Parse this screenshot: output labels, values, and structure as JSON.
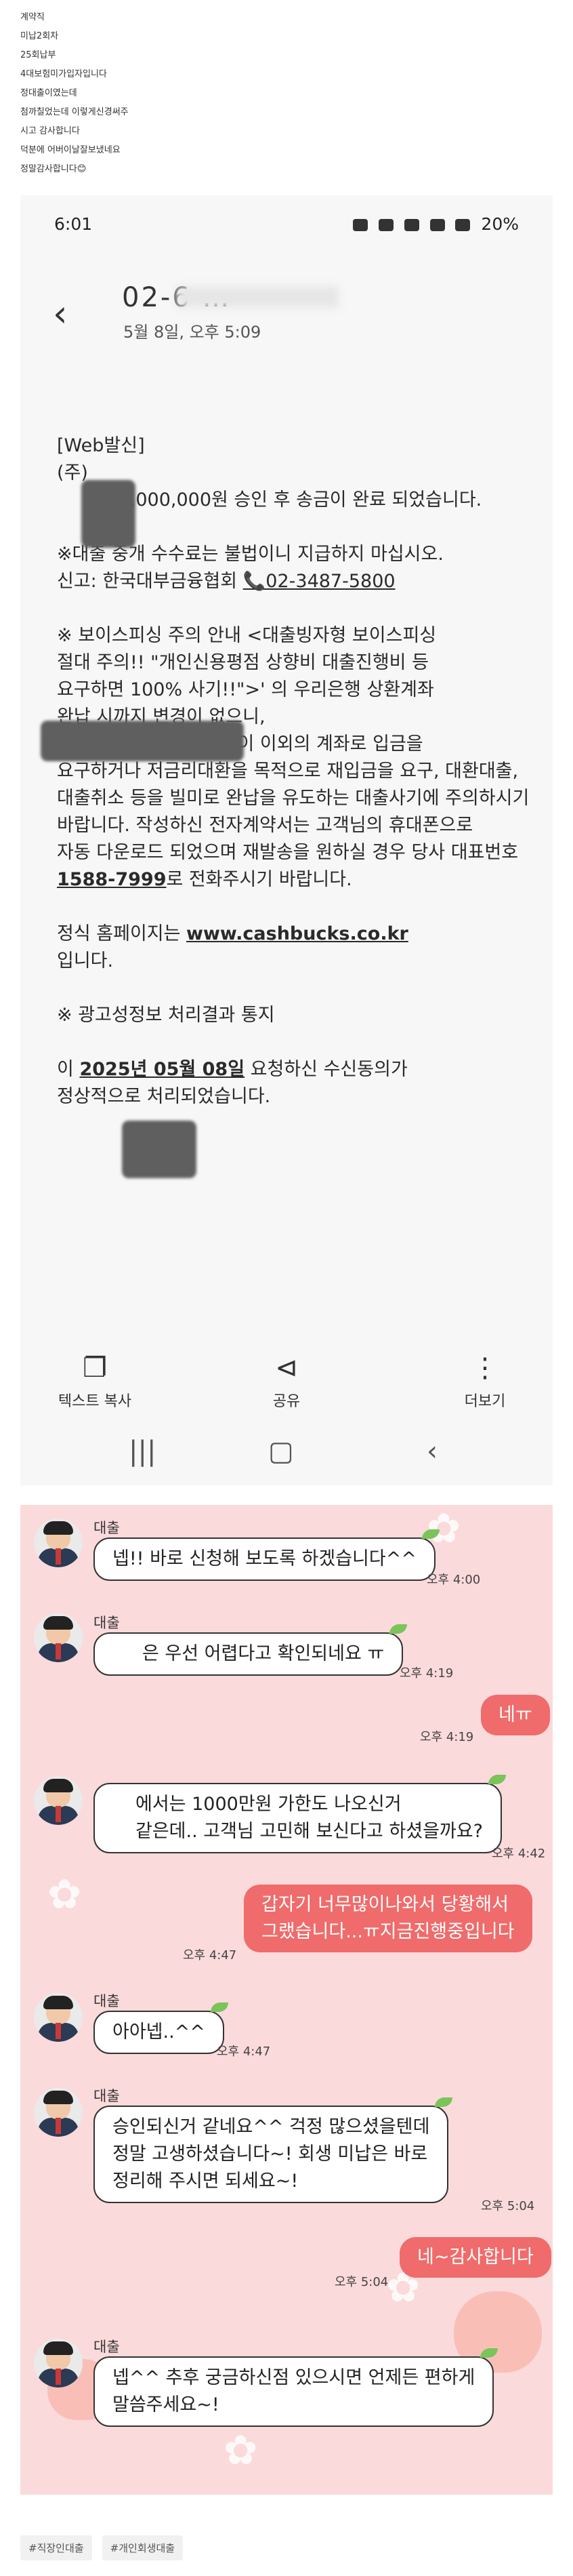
{
  "intro": {
    "lines": [
      "계약직",
      "미납2회차",
      "25회납부",
      "4대보험미가입자입니다",
      "정대출이였는데",
      "첨까칠었는데 이렇게신경써주",
      "시고 감사합니다",
      "덕분에 어버이날잘보냈네요",
      "정말감사합니다😊"
    ]
  },
  "phone": {
    "status": {
      "time": "6:01",
      "battery": "20%"
    },
    "header": {
      "back_icon": "chevron-left",
      "sender": "02-6 …",
      "date": "5월 8일, 오후 5:09"
    },
    "sms": {
      "line1": "[Web발신]",
      "line2": "(주)",
      "line3": "에 10,000,000원 승인 후 송금이 완료 되었습니다.",
      "line4": "※대출 중개 수수료는 불법이니 지급하지 마십시오.",
      "line5_label": "신고: 한국대부금융협회 ",
      "line5_phone": "📞02-3487-5800",
      "line6": "※ 보이스피싱 주의 안내 <대출빙자형 보이스피싱",
      "line7": "절대 주의!! \"개인신용평점 상향비 대출진행비 등",
      "line8": "요구하면 100% 사기!!\">'                 의 우리은행 상환계좌",
      "line9": "                          완납 시까지 변경이 없으니,",
      "line10": "대출 신청 후 타                  사칭해 이 이외의 계좌로 입금을",
      "line11": "요구하거나 저금리대환을 목적으로 재입금을 요구, 대환대출,",
      "line12": "대출취소 등을 빌미로 완납을 유도하는 대출사기에 주의하시기",
      "line13": "바랍니다. 작성하신 전자계약서는 고객님의 휴대폰으로",
      "line14": "자동 다운로드 되었으며 재발송을 원하실 경우 당사 대표번호",
      "line15_phone": "1588-7999",
      "line15_rest": "로 전화주시기 바랍니다.",
      "line16_pre": "             정식 홈페이지는 ",
      "line16_url": "www.cashbucks.co.kr",
      "line17": "입니다.",
      "line18": "※ 광고성정보 처리결과 통지",
      "line19_pre": "          이 ",
      "line19_date": "2025년 05월 08일",
      "line19_rest": " 요청하신 수신동의가",
      "line20": "정상적으로 처리되었습니다."
    },
    "toolbar": {
      "copy": "텍스트 복사",
      "share": "공유",
      "more": "더보기"
    }
  },
  "chat": {
    "sender_name": "대출",
    "messages": [
      {
        "text": "넵!! 바로 신청해 보도록 하겠습니다^^",
        "time": "오후 4:00"
      },
      {
        "text": "은 우선 어렵다고 확인되네요 ㅠ",
        "time": "오후 4:19"
      },
      {
        "text": "네ㅠ",
        "time": "오후 4:19"
      },
      {
        "line1": "에서는 1000만원 가한도 나오신거",
        "line2": "같은데.. 고객님 고민해 보신다고 하셨을까요?",
        "time": "오후 4:42"
      },
      {
        "line1": "갑자기 너무많이나와서 당황해서",
        "line2": "그랬습니다...ㅠ지금진행중입니다",
        "time": "오후 4:47"
      },
      {
        "text": "아아넵..^^",
        "time": "오후 4:47"
      },
      {
        "line1": "승인되신거 같네요^^ 걱정 많으셨을텐데",
        "line2": "정말 고생하셨습니다~! 회생 미납은 바로",
        "line3": "정리해 주시면 되세요~!",
        "time": "오후 5:04"
      },
      {
        "text": "네~감사합니다",
        "time": "오후 5:04"
      },
      {
        "line1": "넵^^ 추후 궁금하신점 있으시면 언제든 편하게",
        "line2": "말씀주세요~!"
      }
    ]
  },
  "tags": [
    "#직장인대출",
    "#개인회생대출"
  ],
  "colors": {
    "chat_bg": "#fbdadb",
    "my_bubble": "#f06b6b"
  }
}
